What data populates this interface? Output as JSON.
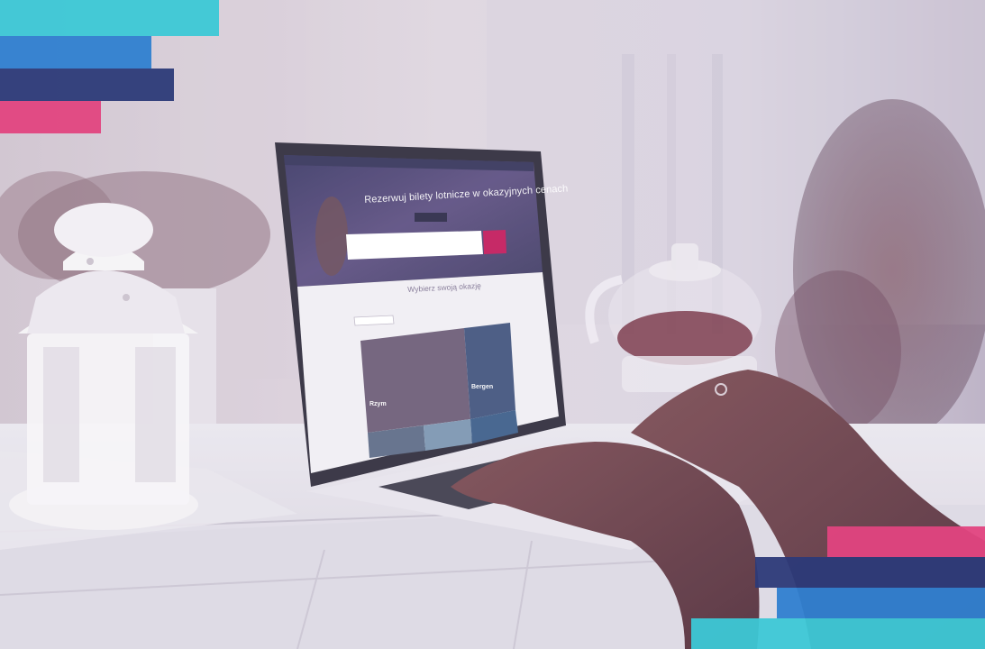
{
  "screen": {
    "headline": "Rezerwuj bilety lotnicze w okazyjnych cenach",
    "section_title": "Wybierz swoją okazję",
    "cities": [
      "Rzym",
      "Bergen"
    ]
  },
  "colors": {
    "cyan": "#3cc8d6",
    "blue": "#2f7fd0",
    "navy": "#2c3a78",
    "pink": "#e2447f",
    "book_button": "#c2185b"
  },
  "icons": [
    "lantern",
    "plant",
    "teapot",
    "laptop",
    "hands"
  ]
}
